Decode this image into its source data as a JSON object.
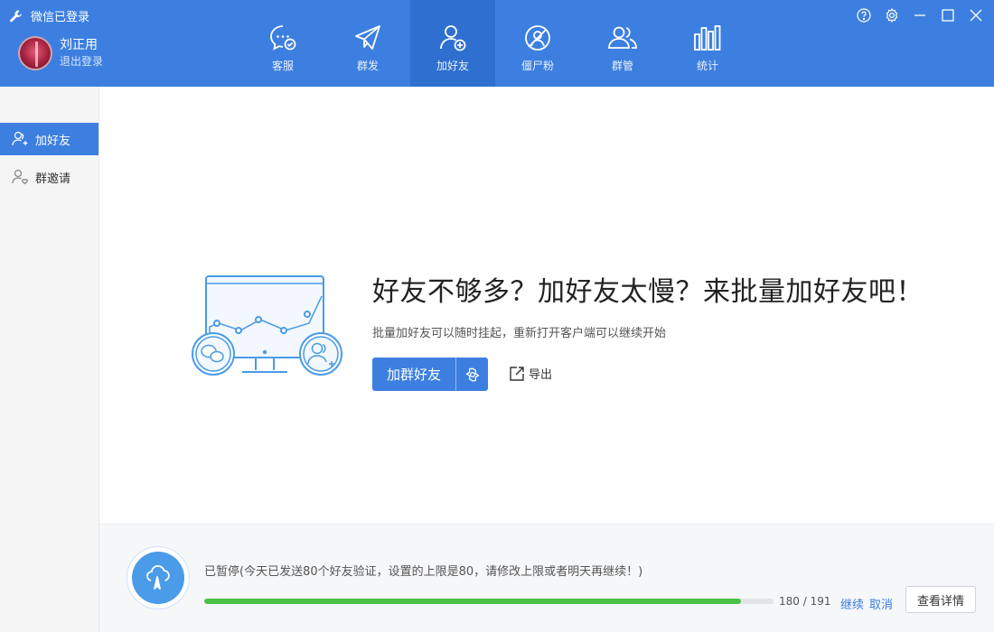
{
  "header": {
    "status": "微信已登录",
    "user": {
      "name": "刘正用",
      "logout": "退出登录"
    },
    "tabs": [
      {
        "label": "客服",
        "icon": "chat-bubble-icon"
      },
      {
        "label": "群发",
        "icon": "paper-plane-icon"
      },
      {
        "label": "加好友",
        "icon": "add-friend-icon",
        "active": true
      },
      {
        "label": "僵尸粉",
        "icon": "zombie-fan-icon"
      },
      {
        "label": "群管",
        "icon": "group-manage-icon"
      },
      {
        "label": "统计",
        "icon": "bar-chart-icon"
      }
    ],
    "window_controls": [
      "help-icon",
      "settings-icon",
      "minimize-icon",
      "maximize-icon",
      "close-icon"
    ]
  },
  "sidebar": {
    "items": [
      {
        "label": "加好友",
        "icon": "add-friend-icon",
        "active": true
      },
      {
        "label": "群邀请",
        "icon": "group-invite-icon"
      }
    ]
  },
  "main": {
    "headline": "好友不够多？加好友太慢？来批量加好友吧！",
    "subline": "批量加好友可以随时挂起，重新打开客户端可以继续开始",
    "primary_button": "加群好友",
    "export_label": "导出"
  },
  "bottom": {
    "status": "已暂停(今天已发送80个好友验证，设置的上限是80，请修改上限或者明天再继续！)",
    "progress": {
      "current": 180,
      "total": 191
    },
    "progress_text": "180 / 191",
    "continue_label": "继续",
    "cancel_label": "取消",
    "detail_button": "查看详情"
  },
  "colors": {
    "primary": "#3d7fe0",
    "active_tab": "#2f6fd0",
    "progress": "#4cc14a",
    "illustration": "#4a9be8"
  }
}
